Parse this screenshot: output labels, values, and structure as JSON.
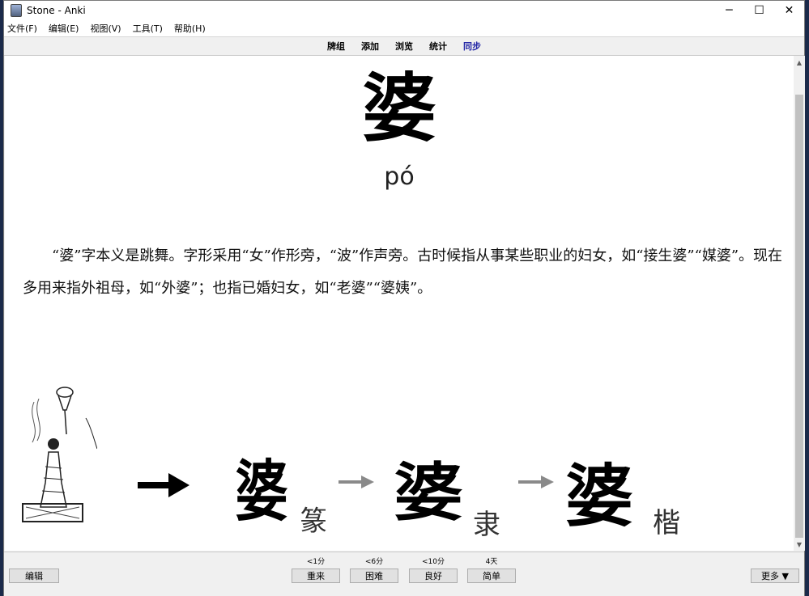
{
  "window": {
    "title": "Stone - Anki"
  },
  "menu": [
    "文件(F)",
    "编辑(E)",
    "视图(V)",
    "工具(T)",
    "帮助(H)"
  ],
  "toolbar": {
    "decks": "牌组",
    "add": "添加",
    "browse": "浏览",
    "stats": "统计",
    "sync": "同步"
  },
  "card": {
    "character": "婆",
    "pinyin": "pó",
    "description": "“婆”字本义是跳舞。字形采用“女”作形旁，“波”作声旁。古时候指从事某些职业的妇女，如“接生婆”“媒婆”。现在多用来指外祖母，如“外婆”；也指已婚妇女，如“老婆”“婆姨”。",
    "evolution": {
      "seal_char": "婆",
      "seal_label": "篆",
      "clerical_char": "婆",
      "clerical_label": "隶",
      "regular_char": "婆",
      "regular_label": "楷"
    }
  },
  "bottom": {
    "edit": "编辑",
    "more": "更多 ▼",
    "answers": [
      {
        "time": "<1分",
        "label": "重来"
      },
      {
        "time": "<6分",
        "label": "困难"
      },
      {
        "time": "<10分",
        "label": "良好"
      },
      {
        "time": "4天",
        "label": "简单"
      }
    ]
  },
  "icons": {
    "app": "anki-app-icon",
    "minimize": "minimize-icon",
    "maximize": "maximize-icon",
    "close": "close-icon"
  }
}
